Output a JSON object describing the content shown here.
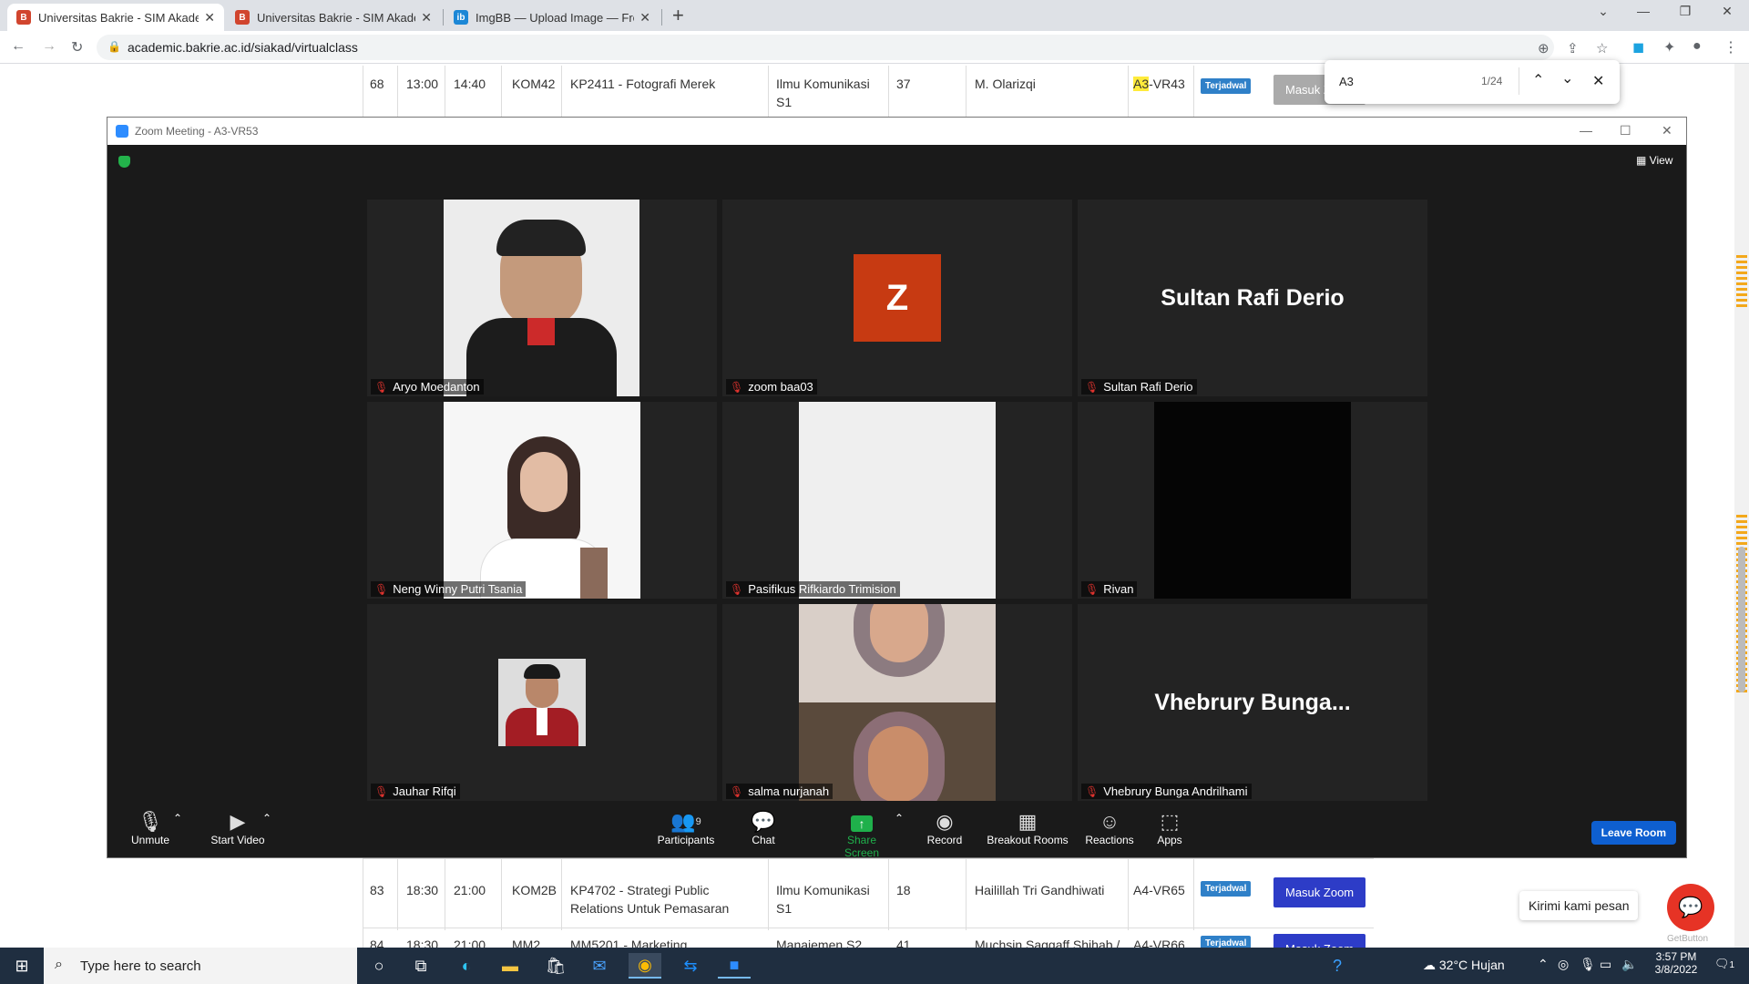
{
  "browser": {
    "tabs": [
      {
        "title": "Universitas Bakrie - SIM Akademik"
      },
      {
        "title": "Universitas Bakrie - SIM Akademik"
      },
      {
        "title": "ImgBB — Upload Image — Free Image Hosting"
      }
    ],
    "new_tab": "+",
    "url": "academic.bakrie.ac.id/siakad/virtualclass"
  },
  "find": {
    "query": "A3",
    "count": "1/24"
  },
  "table": {
    "rows": [
      {
        "no": "68",
        "start": "13:00",
        "end": "14:40",
        "class": "KOM42",
        "course": "KP2411 - Fotografi Merek",
        "program": "Ilmu Komunikasi S1",
        "count": "37",
        "lecturer": "M. Olarizqi",
        "room_hl": "A3",
        "room_rest": "-VR43",
        "status": "Terjadwal",
        "action": "Masuk Zoom"
      },
      {
        "no": "83",
        "start": "18:30",
        "end": "21:00",
        "class": "KOM2B",
        "course": "KP4702 - Strategi Public Relations Untuk Pemasaran",
        "program": "Ilmu Komunikasi S1",
        "count": "18",
        "lecturer": "Hailillah Tri Gandhiwati",
        "room": "A4-VR65",
        "status": "Terjadwal",
        "action": "Masuk Zoom"
      },
      {
        "no": "84",
        "start": "18:30",
        "end": "21:00",
        "class": "MM2",
        "course": "MM5201 - Marketing",
        "program": "Manajemen S2",
        "count": "41",
        "lecturer": "Muchsin Saggaff Shihab /",
        "room": "A4-VR66",
        "status": "Terjadwal",
        "action": "Masuk Zoom"
      }
    ]
  },
  "zoom": {
    "window_title": "Zoom Meeting - A3-VR53",
    "view_label": "View",
    "participants": [
      {
        "name": "Aryo Moedanton"
      },
      {
        "name": "zoom baa03",
        "avatar_letter": "Z"
      },
      {
        "name": "Sultan Rafi Derio",
        "display": "Sultan Rafi Derio"
      },
      {
        "name": "Neng Winny Putri Tsania"
      },
      {
        "name": "Pasifikus Rifkiardo Trimision"
      },
      {
        "name": "Rivan"
      },
      {
        "name": "Jauhar Rifqi"
      },
      {
        "name": "salma nurjanah"
      },
      {
        "name": "Vhebrury Bunga Andrilhami",
        "display": "Vhebrury  Bunga..."
      }
    ],
    "toolbar": {
      "unmute": "Unmute",
      "start_video": "Start Video",
      "participants": "Participants",
      "participants_count": "9",
      "chat": "Chat",
      "share": "Share Screen",
      "record": "Record",
      "breakout": "Breakout Rooms",
      "reactions": "Reactions",
      "apps": "Apps",
      "leave": "Leave Room"
    }
  },
  "chat_widget": {
    "label": "Kirimi kami pesan",
    "brand": "GetButton"
  },
  "taskbar": {
    "search_placeholder": "Type here to search",
    "weather": "32°C  Hujan",
    "time": "3:57 PM",
    "date": "3/8/2022",
    "notif_count": "1"
  },
  "colors": {
    "zoom_blue": "#0e5fd0",
    "badge_blue": "#2f80c8",
    "muted_red": "#e0332e",
    "share_green": "#1fb04b"
  }
}
